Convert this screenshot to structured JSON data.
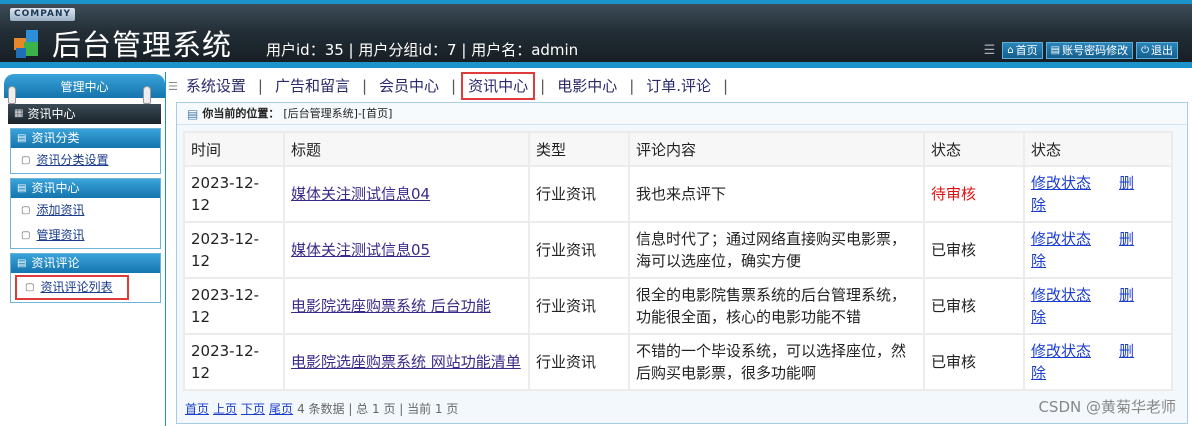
{
  "header": {
    "company": "COMPANY",
    "title": "后台管理系统",
    "user_info": "用户id：35 | 用户分组id：7 | 用户名：admin",
    "buttons": [
      {
        "label": "首页",
        "icon": "home-icon"
      },
      {
        "label": "账号密码修改",
        "icon": "edit-icon"
      },
      {
        "label": "退出",
        "icon": "power-icon"
      }
    ]
  },
  "sidebar": {
    "head": "管理中心",
    "selected_section": "资讯中心",
    "groups": [
      {
        "title": "资讯分类",
        "items": [
          "资讯分类设置"
        ]
      },
      {
        "title": "资讯中心",
        "items": [
          "添加资讯",
          "管理资讯"
        ]
      },
      {
        "title": "资讯评论",
        "items": [
          "资讯评论列表"
        ]
      }
    ]
  },
  "topnav": {
    "tabs": [
      "系统设置",
      "广告和留言",
      "会员中心",
      "资讯中心",
      "电影中心",
      "订单.评论"
    ],
    "active": "资讯中心"
  },
  "location": {
    "label": "你当前的位置：",
    "path": "[后台管理系统]-[首页]"
  },
  "table": {
    "headers": [
      "时间",
      "标题",
      "类型",
      "评论内容",
      "状态",
      "状态"
    ],
    "rows": [
      {
        "time": "2023-12-12",
        "title": "媒体关注测试信息04",
        "type": "行业资讯",
        "content": "我也来点评下",
        "status": "待审核",
        "op1": "修改状态",
        "op2": "删除"
      },
      {
        "time": "2023-12-12",
        "title": "媒体关注测试信息05",
        "type": "行业资讯",
        "content": "信息时代了；通过网络直接购买电影票，海可以选座位，确实方便",
        "status": "已审核",
        "op1": "修改状态",
        "op2": "删除"
      },
      {
        "time": "2023-12-12",
        "title": "电影院选座购票系统 后台功能",
        "type": "行业资讯",
        "content": "很全的电影院售票系统的后台管理系统，功能很全面，核心的电影功能不错",
        "status": "已审核",
        "op1": "修改状态",
        "op2": "删除"
      },
      {
        "time": "2023-12-12",
        "title": "电影院选座购票系统 网站功能清单",
        "type": "行业资讯",
        "content": "不错的一个毕设系统，可以选择座位，然后购买电影票，很多功能啊",
        "status": "已审核",
        "op1": "修改状态",
        "op2": "删除"
      }
    ]
  },
  "pager": {
    "first": "首页",
    "prev": "上页",
    "next": "下页",
    "last": "尾页",
    "summary": "4 条数据 | 总 1 页 | 当前 1 页"
  },
  "watermark": "CSDN @黄菊华老师"
}
